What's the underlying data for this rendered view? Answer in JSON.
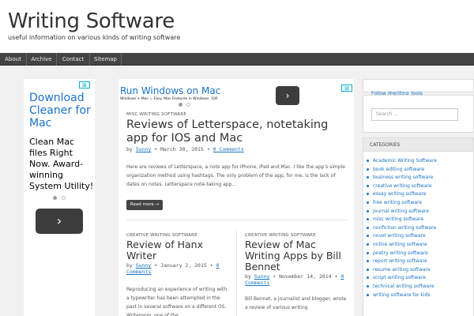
{
  "site": {
    "title": "Writing Software",
    "tagline": "useful information on various kinds of writing software"
  },
  "nav": {
    "items": [
      "About",
      "Archive",
      "Contact",
      "Sitemap"
    ]
  },
  "ad_left": {
    "title": "Download Cleaner for Mac",
    "body": "Clean Mac files Right Now. Award-winning System Utility!",
    "button_icon": "chevron-right-icon",
    "button_glyph": "›"
  },
  "ad_top": {
    "title": "Run Windows on Mac",
    "body": "Windows + Mac = Easy. Mac Features in Windows. 10€",
    "button_icon": "chevron-right-icon",
    "button_glyph": "›"
  },
  "ad_close": "⊠",
  "posts": [
    {
      "category": "MISC WRITING SOFTWARE",
      "title": "Reviews of Letterspace, notetaking app for IOS and Mac",
      "by": "by",
      "author": "Sunny",
      "date": "March 30, 2015",
      "comments": "0 Comments",
      "excerpt": "Here are reviews of Letterspace, a note app for iPhone, iPad and Mac. I like the app's simple organization method using hashtags. The only problem of the app, for me, is the lack of dates on notes. Letterspace note-taking app…",
      "read_more": "Read more →"
    },
    {
      "category": "CREATIVE WRITING SOFTWARE",
      "title": "Review of Hanx Writer",
      "by": "by",
      "author": "Sunny",
      "date": "January 2, 2015",
      "comments": "0 Comments",
      "excerpt": "Reproducing an experience of writing with a typewriter has been attempted in the past in several software on a different OS. Writeroom, one of the"
    },
    {
      "category": "CREATIVE WRITING SOFTWARE",
      "title": "Review of Mac Writing Apps by Bill Bennet",
      "by": "by",
      "author": "Sunny",
      "date": "November 14, 2014",
      "comments": "0 Comments",
      "excerpt": "Bill Bennet, a journalist and blogger, wrote a review of various writing"
    }
  ],
  "sidebar": {
    "follow": "Follow @writing_tools",
    "search_placeholder": "Search …",
    "categories_heading": "CATEGORIES",
    "categories": [
      "Academic Writing Software",
      "book editing software",
      "business writing software",
      "creative writing software",
      "essay writing software",
      "free writing software",
      "journal writing software",
      "misc writing software",
      "nonfiction writing software",
      "novel writing software",
      "online writing software",
      "poetry writing software",
      "report writing software",
      "resume writing software",
      "script writing software",
      "technical writing software",
      "writing software for kids"
    ]
  },
  "colors": {
    "link": "#1a73c5",
    "nav_bg": "#444444",
    "ad_dot": "#00aecd"
  }
}
